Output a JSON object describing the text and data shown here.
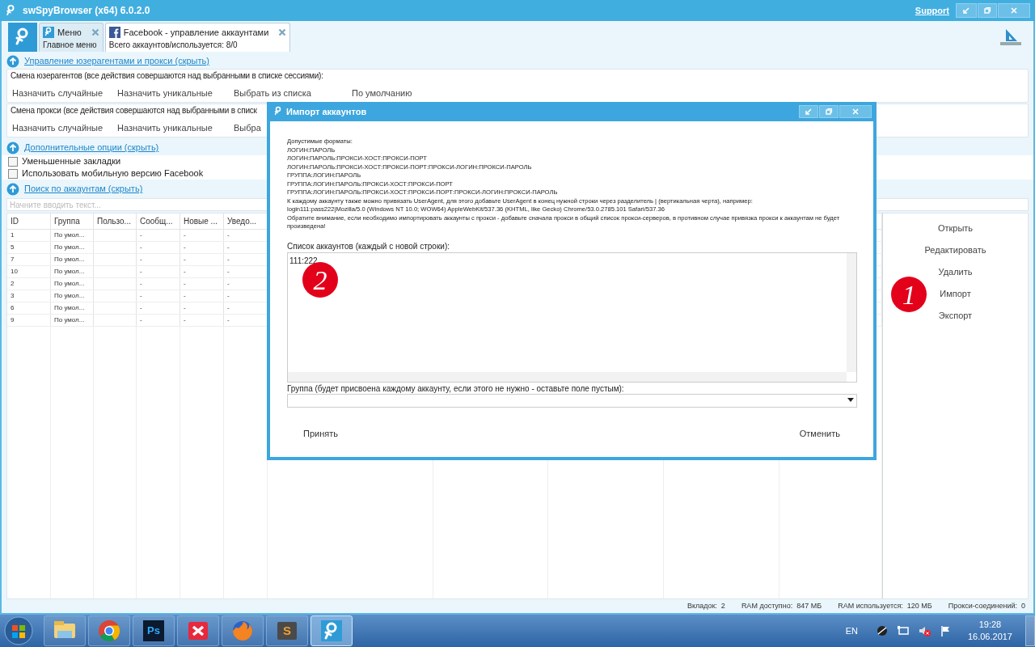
{
  "window": {
    "title": "swSpyBrowser (x64) 6.0.2.0",
    "support_link": "Support"
  },
  "tabs": [
    {
      "title": "Меню",
      "subtitle": "Главное меню",
      "kind": "app",
      "selected": false
    },
    {
      "title": "Facebook - управление аккаунтами",
      "subtitle": "Всего аккаунтов/используется: 8/0",
      "kind": "facebook",
      "selected": true
    }
  ],
  "agent_section": {
    "link": "Управление юзерагентами и прокси (скрыть)",
    "groups": [
      {
        "label": "Смена юзерагентов (все действия совершаются над выбранными в списке сессиями):",
        "buttons": [
          "Назначить случайные",
          "Назначить уникальные",
          "Выбрать из списка",
          "По умолчанию"
        ]
      },
      {
        "label": "Смена прокси (все действия совершаются над выбранными в списк",
        "buttons": [
          "Назначить случайные",
          "Назначить уникальные",
          "Выбра"
        ]
      }
    ]
  },
  "options_section": {
    "link": "Дополнительные опции (скрыть)",
    "checkboxes": [
      {
        "label": "Уменьшенные закладки",
        "checked": false
      },
      {
        "label": "Использовать мобильную версию Facebook",
        "checked": false
      }
    ]
  },
  "search_section": {
    "link": "Поиск по аккаунтам (скрыть)",
    "placeholder": "Начните вводить текст..."
  },
  "table": {
    "columns": [
      "ID",
      "Группа",
      "Пользо...",
      "Сообщ...",
      "Новые ...",
      "Уведо..."
    ],
    "rows": [
      [
        "1",
        "По умол...",
        "",
        "-",
        "-",
        "-"
      ],
      [
        "5",
        "По умол...",
        "",
        "-",
        "-",
        "-"
      ],
      [
        "7",
        "По умол...",
        "",
        "-",
        "-",
        "-"
      ],
      [
        "10",
        "По умол...",
        "",
        "-",
        "-",
        "-"
      ],
      [
        "2",
        "По умол...",
        "",
        "-",
        "-",
        "-"
      ],
      [
        "3",
        "По умол...",
        "",
        "-",
        "-",
        "-"
      ],
      [
        "6",
        "По умол...",
        "",
        "-",
        "-",
        "-"
      ],
      [
        "9",
        "По умол...",
        "",
        "-",
        "-",
        "-"
      ]
    ]
  },
  "actions": [
    {
      "label": "Открыть"
    },
    {
      "label": "Редактировать"
    },
    {
      "label": "Удалить"
    },
    {
      "label": "Импорт",
      "callout": "1"
    },
    {
      "label": "Экспорт"
    }
  ],
  "status_bar": [
    "Вкладок:  2",
    "RAM доступно:  847 МБ",
    "RAM используется:  120 МБ",
    "Прокси-соединений:  0"
  ],
  "dialog": {
    "title": "Импорт аккаунтов",
    "help_lines": [
      "Допустимые форматы:",
      "ЛОГИН:ПАРОЛЬ",
      "ЛОГИН:ПАРОЛЬ:ПРОКСИ-ХОСТ:ПРОКСИ-ПОРТ",
      "ЛОГИН:ПАРОЛЬ:ПРОКСИ-ХОСТ:ПРОКСИ-ПОРТ:ПРОКСИ-ЛОГИН:ПРОКСИ-ПАРОЛЬ",
      "ГРУППА:ЛОГИН:ПАРОЛЬ",
      "ГРУППА:ЛОГИН:ПАРОЛЬ:ПРОКСИ-ХОСТ:ПРОКСИ-ПОРТ",
      "ГРУППА:ЛОГИН:ПАРОЛЬ:ПРОКСИ-ХОСТ:ПРОКСИ-ПОРТ:ПРОКСИ-ЛОГИН:ПРОКСИ-ПАРОЛЬ",
      "К каждому аккаунту также можно привязать UserAgent, для этого добавьте UserAgent в конец нужной строки через разделитель | (вертикальная черта), например:",
      "login111:pass222|Mozilla/5.0 (Windows NT 10.0; WOW64) AppleWebKit/537.36 (KHTML, like Gecko) Chrome/53.0.2785.101 Safari/537.36",
      "Обратите внимание, если необходимо импортировать аккаунты с прокси - добавьте сначала прокси в общий список прокси-серверов, в противном случае привязка прокси к аккаунтам не будет произведена!"
    ],
    "accounts_label": "Список аккаунтов (каждый с новой строки):",
    "accounts_value": "111:222",
    "callout": "2",
    "group_label": "Группа (будет присвоена каждому аккаунту, если этого не нужно - оставьте поле пустым):",
    "buttons": [
      "Принять",
      "Отменить"
    ]
  },
  "taskbar": {
    "apps": [
      {
        "kind": "explorer",
        "selected": false
      },
      {
        "kind": "chrome",
        "selected": false
      },
      {
        "kind": "photoshop",
        "label": "Ps",
        "selected": false
      },
      {
        "kind": "xmind",
        "selected": false
      },
      {
        "kind": "firefox",
        "selected": false
      },
      {
        "kind": "sublime",
        "label": "S",
        "selected": false
      },
      {
        "kind": "spybrowser",
        "selected": true
      }
    ],
    "language": "EN",
    "time": "19:28",
    "date": "16.06.2017"
  }
}
